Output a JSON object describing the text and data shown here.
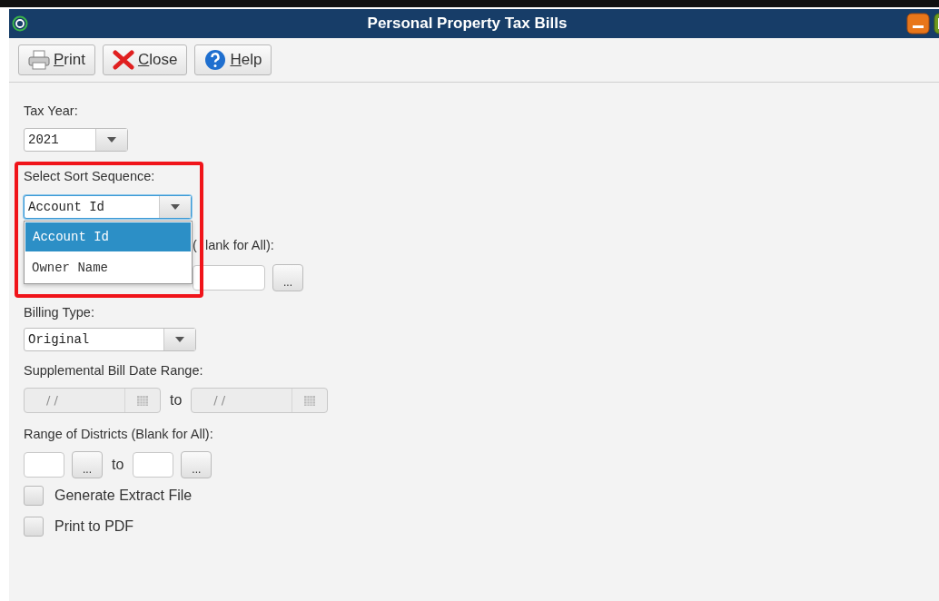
{
  "window": {
    "title": "Personal Property Tax Bills"
  },
  "toolbar": [
    {
      "label": "Print",
      "kind": "print"
    },
    {
      "label": "Close",
      "kind": "close"
    },
    {
      "label": "Help",
      "kind": "help"
    }
  ],
  "tax_year": {
    "label": "Tax Year:",
    "value": "2021"
  },
  "sort_sequence": {
    "label": "Select Sort Sequence:",
    "value": "Account Id",
    "expanded": true,
    "options": [
      {
        "label": "Account Id",
        "selected": true
      },
      {
        "label": "Owner Name",
        "selected": false
      }
    ]
  },
  "account_range": {
    "label_start": "(",
    "label": "lank for All):",
    "browse": "..."
  },
  "billing_type": {
    "label": "Billing Type:",
    "value": "Original"
  },
  "date_range": {
    "label": "Supplemental Bill Date Range:",
    "separator": "to",
    "from": {
      "placeholder": "/ /",
      "disabled": true
    },
    "to": {
      "placeholder": "/ /",
      "disabled": true
    }
  },
  "districts": {
    "label": "Range of Districts (Blank for All):",
    "separator": "to",
    "from_browse": "...",
    "to_browse": "..."
  },
  "checkboxes": [
    {
      "label": "Generate Extract File",
      "checked": false
    },
    {
      "label": "Print to PDF",
      "checked": false
    }
  ]
}
